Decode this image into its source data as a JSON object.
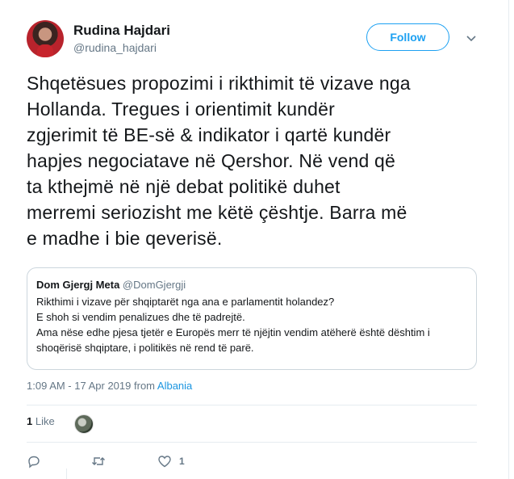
{
  "author": {
    "name": "Rudina Hajdari",
    "handle": "@rudina_hajdari"
  },
  "follow_label": "Follow",
  "tweet": {
    "lines": [
      "Shqetësues propozimi i rikthimit të vizave nga",
      "Hollanda. Tregues i orientimit kundër",
      "zgjerimit të BE-së & indikator i qartë kundër",
      "hapjes negociatave në Qershor. Në vend që",
      "ta kthejmë në një debat politikë duhet",
      "merremi seriozisht me këtë çështje. Barra më",
      "e madhe i bie qeverisë."
    ]
  },
  "quoted": {
    "name": "Dom Gjergj Meta",
    "handle": "@DomGjergji",
    "lines": [
      "Rikthimi i vizave për shqiptarët nga ana e parlamentit holandez?",
      "E shoh si vendim penalizues dhe të padrejtë.",
      "Ama nëse edhe pjesa tjetër e Europës merr të njëjtin vendim atëherë është dështim i",
      "shoqërisë shqiptare, i politikës në rend të parë."
    ]
  },
  "meta": {
    "timestamp": "1:09 AM - 17 Apr 2019",
    "from_label": "from",
    "location": "Albania"
  },
  "stats": {
    "like_count": "1",
    "like_label": "Like"
  },
  "actions": {
    "like_count": "1"
  },
  "icons": {
    "reply": "reply-icon",
    "retweet": "retweet-icon",
    "like": "heart-icon",
    "more": "chevron-down-icon"
  },
  "colors": {
    "accent": "#1da1f2",
    "link": "#1b95e0",
    "muted": "#657786",
    "text": "#14171a",
    "border": "#e6ecf0"
  }
}
